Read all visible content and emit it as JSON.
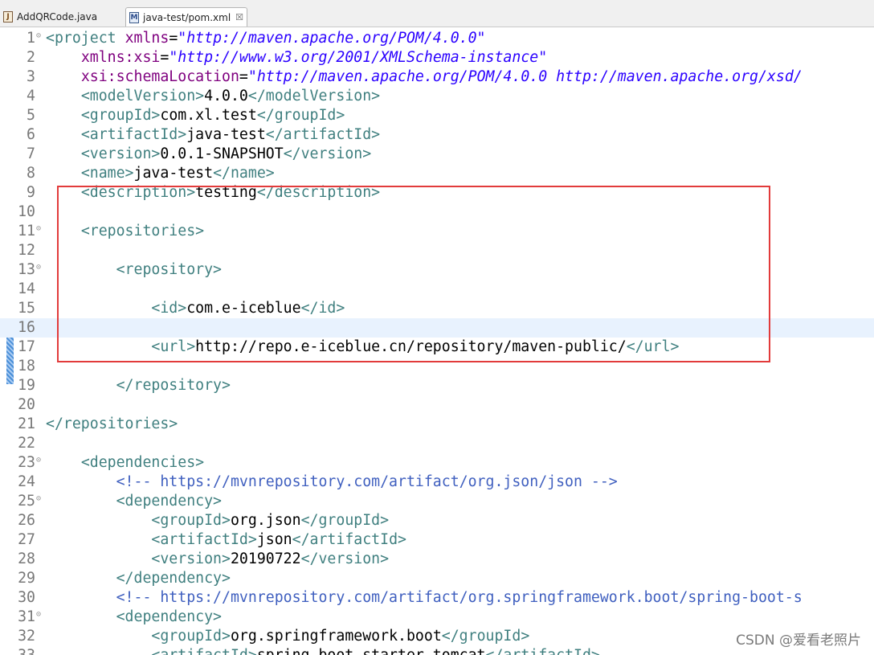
{
  "tabs": [
    {
      "label": "AddQRCode.java",
      "icon": "java-file-icon",
      "active": false
    },
    {
      "label": "java-test/pom.xml",
      "icon": "xml-file-icon",
      "active": true,
      "close": "☒"
    }
  ],
  "lines": [
    {
      "n": "1",
      "fold": "⊝",
      "tokens": [
        [
          "t",
          "<project "
        ],
        [
          "a",
          "xmlns"
        ],
        [
          "eq",
          "="
        ],
        [
          "v",
          "\"http://maven.apache.org/POM/4.0.0\""
        ]
      ]
    },
    {
      "n": "2",
      "tokens": [
        [
          "x",
          "    "
        ],
        [
          "a",
          "xmlns:xsi"
        ],
        [
          "eq",
          "="
        ],
        [
          "v",
          "\"http://www.w3.org/2001/XMLSchema-instance\""
        ]
      ]
    },
    {
      "n": "3",
      "tokens": [
        [
          "x",
          "    "
        ],
        [
          "a",
          "xsi:schemaLocation"
        ],
        [
          "eq",
          "="
        ],
        [
          "v",
          "\"http://maven.apache.org/POM/4.0.0 http://maven.apache.org/xsd/"
        ]
      ]
    },
    {
      "n": "4",
      "tokens": [
        [
          "x",
          "    "
        ],
        [
          "t",
          "<modelVersion>"
        ],
        [
          "x",
          "4.0.0"
        ],
        [
          "t",
          "</modelVersion>"
        ]
      ]
    },
    {
      "n": "5",
      "tokens": [
        [
          "x",
          "    "
        ],
        [
          "t",
          "<groupId>"
        ],
        [
          "x",
          "com.xl.test"
        ],
        [
          "t",
          "</groupId>"
        ]
      ]
    },
    {
      "n": "6",
      "tokens": [
        [
          "x",
          "    "
        ],
        [
          "t",
          "<artifactId>"
        ],
        [
          "x",
          "java-test"
        ],
        [
          "t",
          "</artifactId>"
        ]
      ]
    },
    {
      "n": "7",
      "tokens": [
        [
          "x",
          "    "
        ],
        [
          "t",
          "<version>"
        ],
        [
          "x",
          "0.0.1-SNAPSHOT"
        ],
        [
          "t",
          "</version>"
        ]
      ]
    },
    {
      "n": "8",
      "tokens": [
        [
          "x",
          "    "
        ],
        [
          "t",
          "<name>"
        ],
        [
          "x",
          "java-test"
        ],
        [
          "t",
          "</name>"
        ]
      ]
    },
    {
      "n": "9",
      "tokens": [
        [
          "x",
          "    "
        ],
        [
          "t",
          "<description>"
        ],
        [
          "x",
          "testing"
        ],
        [
          "t",
          "</description>"
        ]
      ]
    },
    {
      "n": "10",
      "tokens": []
    },
    {
      "n": "11",
      "fold": "⊝",
      "tokens": [
        [
          "x",
          "    "
        ],
        [
          "t",
          "<repositories>"
        ]
      ]
    },
    {
      "n": "12",
      "tokens": []
    },
    {
      "n": "13",
      "fold": "⊝",
      "tokens": [
        [
          "x",
          "        "
        ],
        [
          "t",
          "<repository>"
        ]
      ]
    },
    {
      "n": "14",
      "tokens": []
    },
    {
      "n": "15",
      "tokens": [
        [
          "x",
          "            "
        ],
        [
          "t",
          "<id>"
        ],
        [
          "x",
          "com.e-iceblue"
        ],
        [
          "t",
          "</id>"
        ]
      ]
    },
    {
      "n": "16",
      "current": true,
      "tokens": []
    },
    {
      "n": "17",
      "tokens": [
        [
          "x",
          "            "
        ],
        [
          "t",
          "<url>"
        ],
        [
          "x",
          "http://repo.e-iceblue.cn/repository/maven-public/"
        ],
        [
          "t",
          "</url>"
        ]
      ]
    },
    {
      "n": "18",
      "tokens": []
    },
    {
      "n": "19",
      "tokens": [
        [
          "x",
          "        "
        ],
        [
          "t",
          "</repository>"
        ]
      ]
    },
    {
      "n": "20",
      "tokens": []
    },
    {
      "n": "21",
      "tokens": [
        [
          "t",
          "</repositories>"
        ]
      ]
    },
    {
      "n": "22",
      "tokens": []
    },
    {
      "n": "23",
      "fold": "⊝",
      "tokens": [
        [
          "x",
          "    "
        ],
        [
          "t",
          "<dependencies>"
        ]
      ]
    },
    {
      "n": "24",
      "tokens": [
        [
          "x",
          "        "
        ],
        [
          "c",
          "<!-- https://mvnrepository.com/artifact/org.json/json -->"
        ]
      ]
    },
    {
      "n": "25",
      "fold": "⊝",
      "tokens": [
        [
          "x",
          "        "
        ],
        [
          "t",
          "<dependency>"
        ]
      ]
    },
    {
      "n": "26",
      "tokens": [
        [
          "x",
          "            "
        ],
        [
          "t",
          "<groupId>"
        ],
        [
          "x",
          "org.json"
        ],
        [
          "t",
          "</groupId>"
        ]
      ]
    },
    {
      "n": "27",
      "tokens": [
        [
          "x",
          "            "
        ],
        [
          "t",
          "<artifactId>"
        ],
        [
          "x",
          "json"
        ],
        [
          "t",
          "</artifactId>"
        ]
      ]
    },
    {
      "n": "28",
      "tokens": [
        [
          "x",
          "            "
        ],
        [
          "t",
          "<version>"
        ],
        [
          "x",
          "20190722"
        ],
        [
          "t",
          "</version>"
        ]
      ]
    },
    {
      "n": "29",
      "tokens": [
        [
          "x",
          "        "
        ],
        [
          "t",
          "</dependency>"
        ]
      ]
    },
    {
      "n": "30",
      "tokens": [
        [
          "x",
          "        "
        ],
        [
          "c",
          "<!-- https://mvnrepository.com/artifact/org.springframework.boot/spring-boot-s"
        ]
      ]
    },
    {
      "n": "31",
      "fold": "⊝",
      "tokens": [
        [
          "x",
          "        "
        ],
        [
          "t",
          "<dependency>"
        ]
      ]
    },
    {
      "n": "32",
      "tokens": [
        [
          "x",
          "            "
        ],
        [
          "t",
          "<groupId>"
        ],
        [
          "x",
          "org.springframework.boot"
        ],
        [
          "t",
          "</groupId>"
        ]
      ]
    },
    {
      "n": "33",
      "tokens": [
        [
          "x",
          "            "
        ],
        [
          "t",
          "<artifactId>"
        ],
        [
          "x",
          "spring-boot-starter-tomcat"
        ],
        [
          "t",
          "</artifactId>"
        ]
      ]
    }
  ],
  "watermark": "CSDN @爱看老照片"
}
